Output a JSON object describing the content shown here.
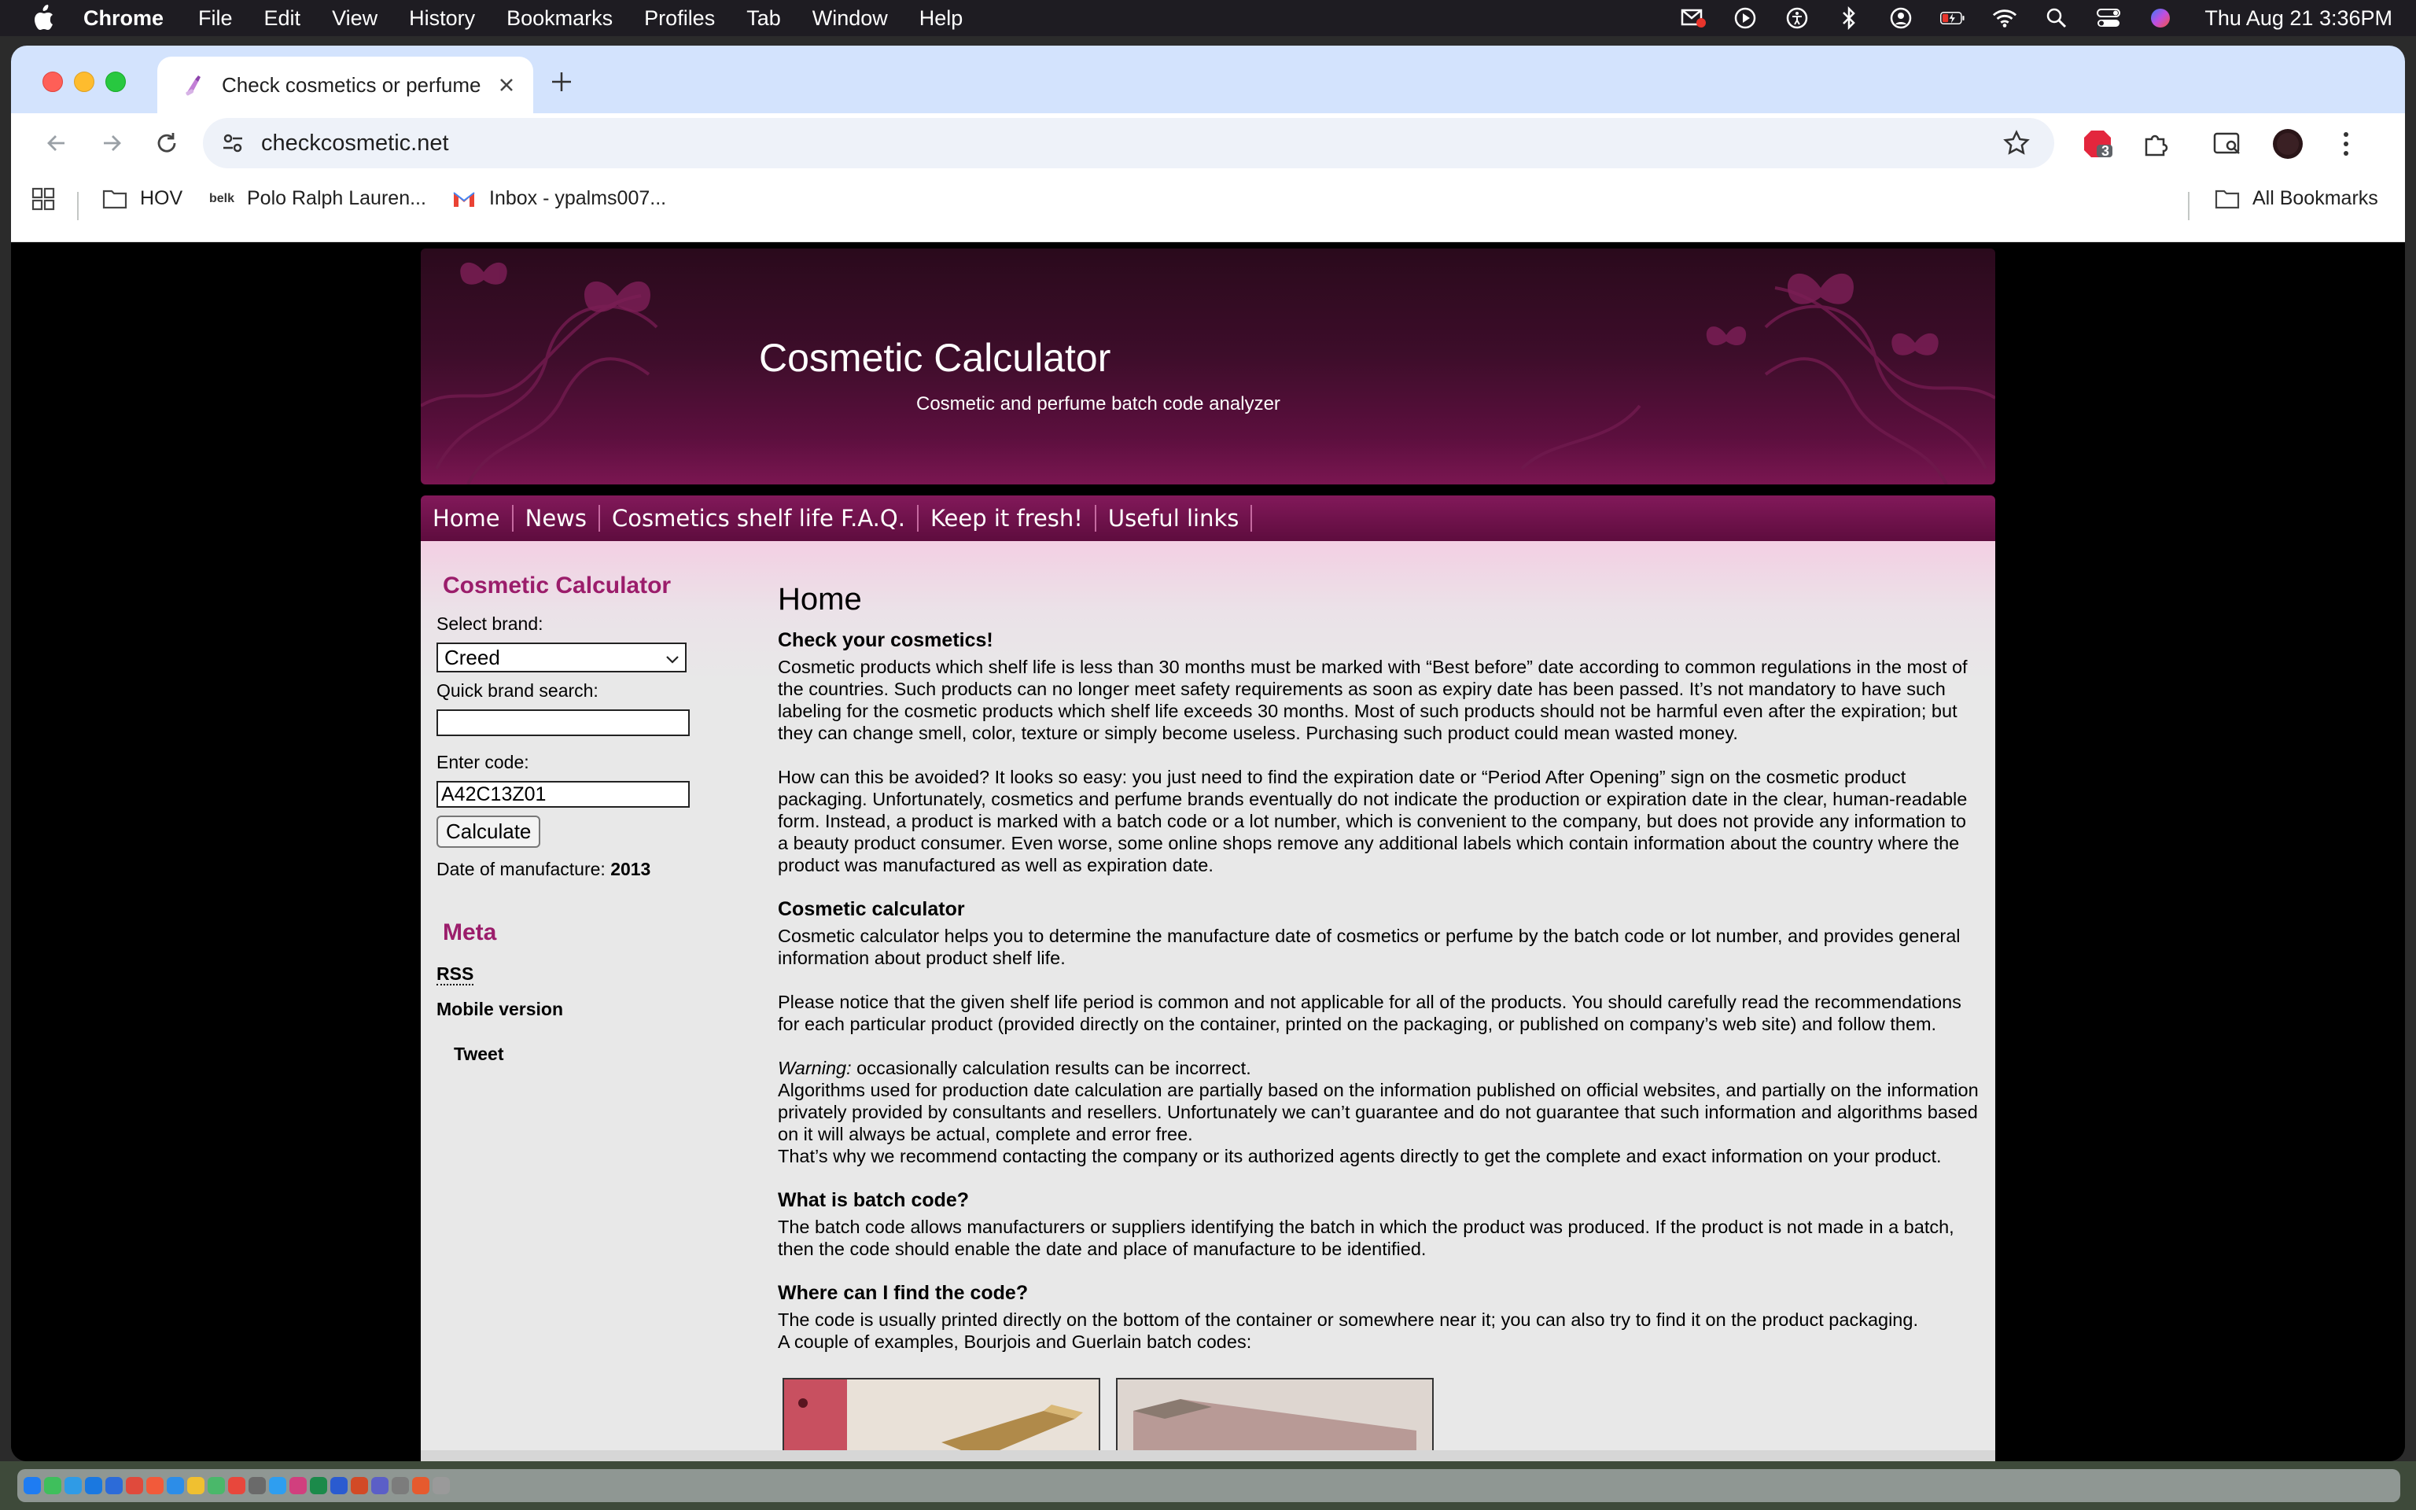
{
  "menubar": {
    "app_name": "Chrome",
    "items": [
      "File",
      "Edit",
      "View",
      "History",
      "Bookmarks",
      "Profiles",
      "Tab",
      "Window",
      "Help"
    ],
    "clock": "Thu Aug 21  3:36PM"
  },
  "browser": {
    "tab_title": "Check cosmetics or perfume",
    "url": "checkcosmetic.net",
    "extension_badge": "3",
    "bookmarks": [
      {
        "label": "HOV",
        "icon": "folder-icon"
      },
      {
        "label": "Polo Ralph Lauren...",
        "icon": "belk-icon"
      },
      {
        "label": "Inbox - ypalms007...",
        "icon": "gmail-icon"
      }
    ],
    "all_bookmarks": "All Bookmarks"
  },
  "site": {
    "title": "Cosmetic Calculator",
    "subtitle": "Cosmetic and perfume batch code analyzer",
    "nav": [
      "Home",
      "News",
      "Cosmetics shelf life F.A.Q.",
      "Keep it fresh!",
      "Useful links"
    ]
  },
  "sidebar": {
    "calc_heading": "Cosmetic Calculator",
    "brand_label": "Select brand:",
    "brand_value": "Creed",
    "search_label": "Quick brand search:",
    "search_value": "",
    "code_label": "Enter code:",
    "code_value": "A42C13Z01",
    "calculate_label": "Calculate",
    "result_label": "Date of manufacture:",
    "result_value": "2013",
    "meta_heading": "Meta",
    "rss": "RSS",
    "mobile": "Mobile version",
    "tweet": "Tweet"
  },
  "main": {
    "heading": "Home",
    "s1_title": "Check your cosmetics!",
    "s1_p1": "Cosmetic products which shelf life is less than 30 months must be marked with “Best before” date according to common regulations in the most of the countries. Such products can no longer meet safety requirements as soon as expiry date has been passed. It’s not mandatory to have such labeling for the cosmetic products which shelf life exceeds 30 months. Most of such products should not be harmful even after the expiration; but they can change smell, color, texture or simply become useless. Purchasing such product could mean wasted money.",
    "s1_p2": "How can this be avoided? It looks so easy: you just need to find the expiration date or “Period After Opening” sign on the cosmetic product packaging. Unfortunately, cosmetics and perfume brands eventually do not indicate the production or expiration date in the clear, human-readable form. Instead, a product is marked with a batch code or a lot number, which is convenient to the company, but does not provide any information to a beauty product consumer. Even worse, some online shops remove any additional labels which contain information about the country where the product was manufactured as well as expiration date.",
    "s2_title": "Cosmetic calculator",
    "s2_p1": "Cosmetic calculator helps you to determine the manufacture date of cosmetics or perfume by the batch code or lot number, and provides general information about product shelf life.",
    "s2_p2": "Please notice that the given shelf life period is common and not applicable for all of the products. You should carefully read the recommendations for each particular product (provided directly on the container, printed on the packaging, or published on company’s web site) and follow them.",
    "warning_label": "Warning:",
    "warning_text": " occasionally calculation results can be incorrect.",
    "s2_p3": "Algorithms used for production date calculation are partially based on the information published on official websites, and partially on the information privately provided by consultants and resellers. Unfortunately we can’t guarantee and do not guarantee that such information and algorithms based on it will always be actual, complete and error free.",
    "s2_p4": "That’s why we recommend contacting the company or its authorized agents directly to get the complete and exact information on your product.",
    "s3_title": "What is batch code?",
    "s3_p1": "The batch code allows manufacturers or suppliers identifying the batch in which the product was produced. If the product is not made in a batch, then the code should enable the date and place of manufacture to be identified.",
    "s4_title": "Where can I find the code?",
    "s4_p1": "The code is usually printed directly on the bottom of the container or somewhere near it; you can also try to find it on the product packaging.",
    "s4_p2": "A couple of examples, Bourjois and Guerlain batch codes:"
  },
  "colors": {
    "accent": "#9b1d6b",
    "nav_bg": "#6e1249",
    "header_bg": "#3d0d2a"
  }
}
